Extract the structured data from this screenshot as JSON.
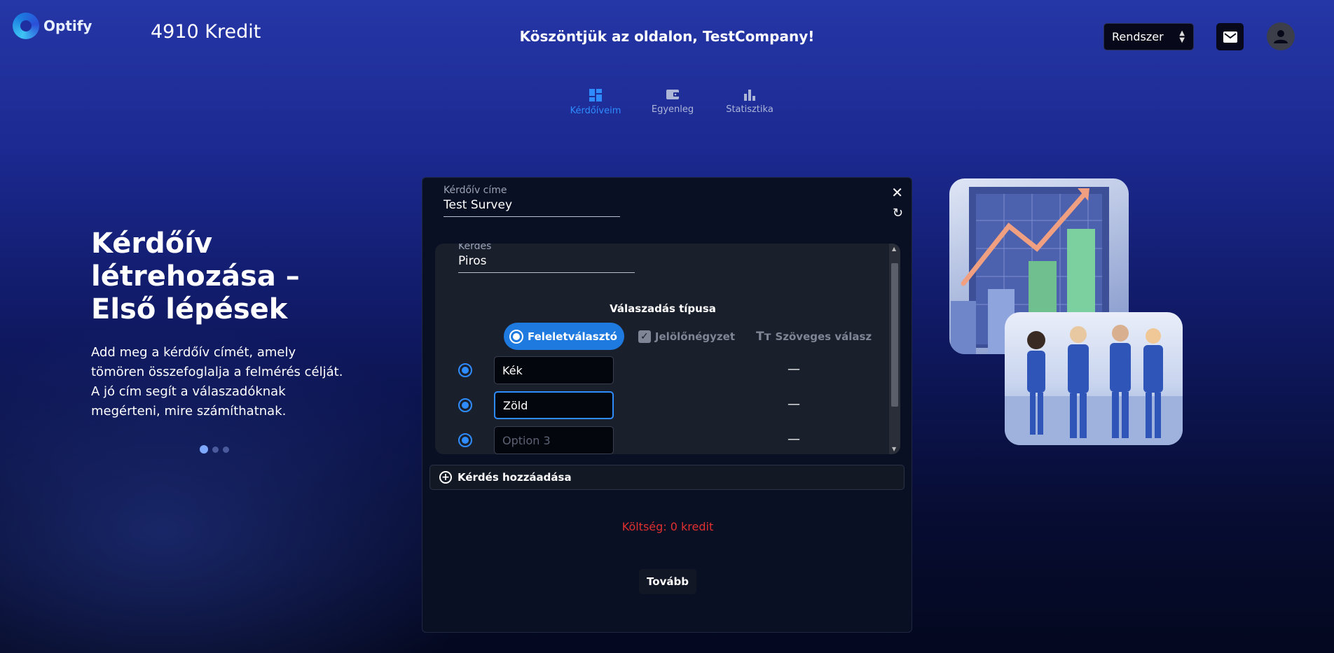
{
  "header": {
    "logo_text": "Optify",
    "credits": "4910 Kredit",
    "welcome": "Köszöntjük az oldalon, TestCompany!",
    "theme_select": "Rendszer"
  },
  "nav": {
    "items": [
      {
        "label": "Kérdőíveim",
        "icon": "dashboard-icon",
        "active": true
      },
      {
        "label": "Egyenleg",
        "icon": "wallet-icon",
        "active": false
      },
      {
        "label": "Statisztika",
        "icon": "bar-chart-icon",
        "active": false
      }
    ]
  },
  "hero": {
    "title": "Kérdőív létrehozása – Első lépések",
    "description": "Add meg a kérdőív címét, amely tömören összefoglalja a felmérés célját. A jó cím segít a válaszadóknak megérteni, mire számíthatnak."
  },
  "modal": {
    "title_label": "Kérdőív címe",
    "title_value": "Test Survey",
    "question_label": "Kérdés",
    "question_value": "Piros",
    "answer_type_title": "Válaszadás típusa",
    "answer_types": [
      "Feleletválasztó",
      "Jelölőnégyzet",
      "Szöveges válasz"
    ],
    "options": [
      {
        "value": "Kék",
        "placeholder": ""
      },
      {
        "value": "Zöld",
        "placeholder": ""
      },
      {
        "value": "",
        "placeholder": "Option 3"
      }
    ],
    "remove_symbol": "—",
    "add_question": "Kérdés hozzáadása",
    "cost": "Költség: 0 kredit",
    "next": "Tovább"
  },
  "colors": {
    "accent": "#2f8cff",
    "active_type": "#1f7ae0",
    "cost": "#e03030"
  }
}
